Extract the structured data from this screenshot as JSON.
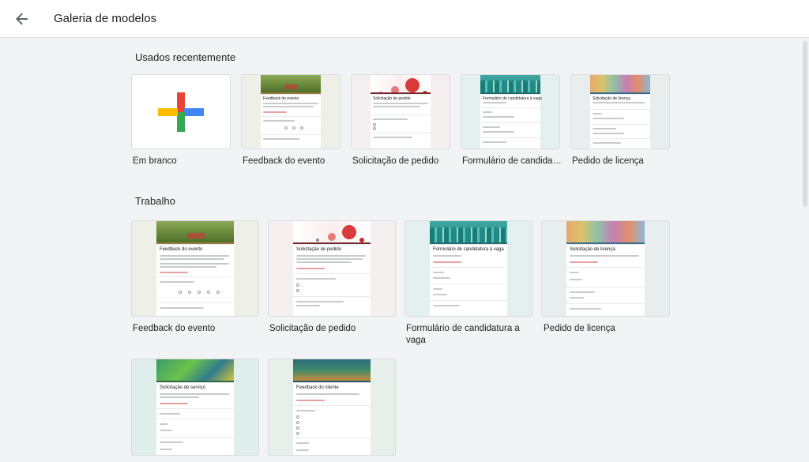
{
  "header": {
    "title": "Galeria de modelos",
    "back_icon": "arrow-back-icon"
  },
  "sections": {
    "recent": {
      "title": "Usados recentemente",
      "items": [
        {
          "label": "Em branco",
          "thumb": "blank-plus"
        },
        {
          "label": "Feedback do evento",
          "thumb": "park"
        },
        {
          "label": "Solicitação de pedido",
          "thumb": "flowers"
        },
        {
          "label": "Formulário de candida…",
          "thumb": "city"
        },
        {
          "label": "Pedido de licença",
          "thumb": "paint"
        }
      ]
    },
    "work": {
      "title": "Trabalho",
      "items": [
        {
          "label": "Feedback do evento",
          "thumb": "park"
        },
        {
          "label": "Solicitação de pedido",
          "thumb": "flowers"
        },
        {
          "label": "Formulário de candidatura a vaga",
          "thumb": "city"
        },
        {
          "label": "Pedido de licença",
          "thumb": "paint"
        },
        {
          "label": "",
          "thumb": "circuit"
        },
        {
          "label": "",
          "thumb": "reeds"
        }
      ]
    }
  },
  "thumb_text": {
    "park_title": "Feedback do evento",
    "flowers_title": "Solicitação de pedido",
    "city_title": "Formulário de candidatura à vaga",
    "paint_title": "Solicitação de licença",
    "circuit_title": "Solicitação de serviço",
    "reeds_title": "Feedback do cliente"
  },
  "colors": {
    "accent_blue": "#4285f4",
    "accent_red": "#ea4335",
    "accent_yellow": "#fbbc05",
    "accent_green": "#34a853",
    "page_bg": "#f1f3f4"
  }
}
